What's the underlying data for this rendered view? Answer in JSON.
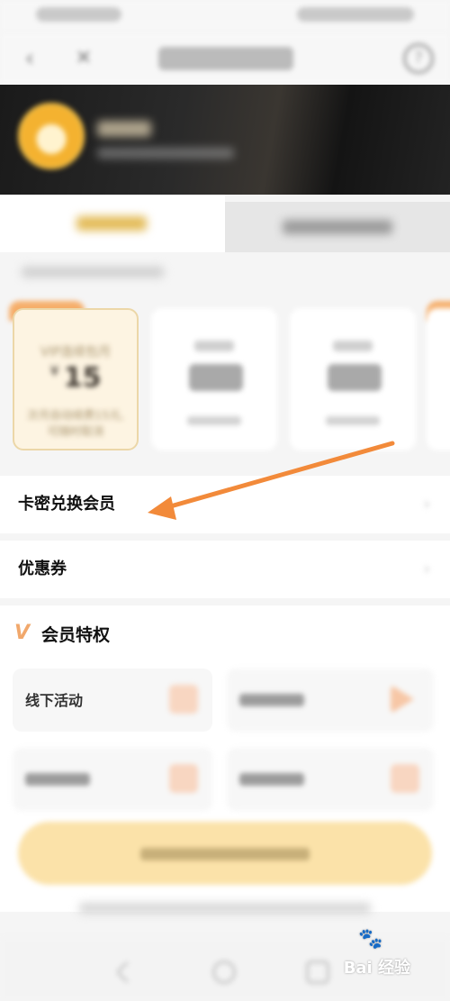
{
  "plans": [
    {
      "title": "VIP连续包月",
      "currency": "¥",
      "price": "15",
      "note_line1": "次月自动续费15元,",
      "note_line2": "可随时取消"
    }
  ],
  "rows": {
    "card_redeem": "卡密兑换会员",
    "coupon": "优惠券",
    "chevron": "›"
  },
  "privileges": {
    "logo": "V",
    "title": "会员特权",
    "tile1": "线下活动"
  },
  "watermark": {
    "text": "Bai 经验",
    "paw": "🐾"
  },
  "nav": {
    "back": "‹",
    "close": "✕",
    "help": "?"
  },
  "colors": {
    "accent_orange": "#f28a3a",
    "gold": "#e3bb57",
    "card_bg": "#fdf4e2"
  }
}
